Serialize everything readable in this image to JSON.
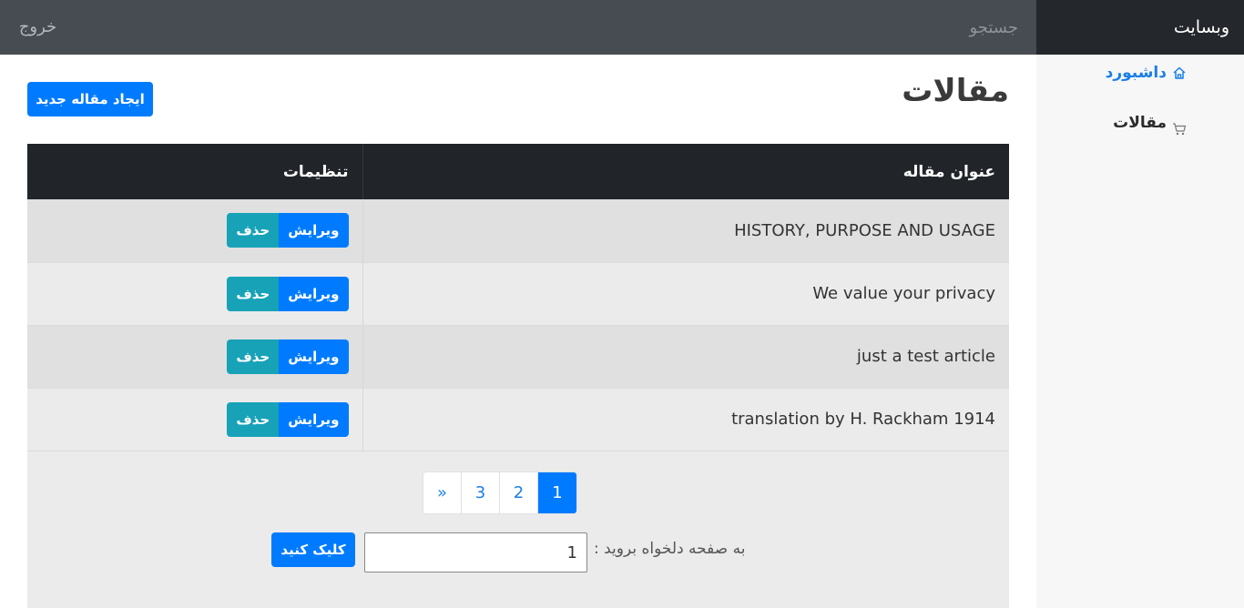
{
  "topbar": {
    "brand": "وبسایت",
    "search_placeholder": "جستجو",
    "logout_label": "خروج"
  },
  "sidebar": {
    "items": [
      {
        "label": "داشبورد",
        "icon": "home-icon",
        "active": true
      },
      {
        "label": "مقالات",
        "icon": "cart-icon",
        "active": false
      }
    ]
  },
  "main": {
    "title": "مقالات",
    "new_button_label": "ایجاد مقاله جدید"
  },
  "table": {
    "headers": [
      "عنوان مقاله",
      "تنظیمات"
    ],
    "edit_label": "ویرایش",
    "delete_label": "حذف",
    "rows": [
      {
        "title": "HISTORY, PURPOSE AND USAGE"
      },
      {
        "title": "We value your privacy"
      },
      {
        "title": "just a test article"
      },
      {
        "title": "translation by H. Rackham 1914"
      }
    ]
  },
  "pagination": {
    "pages": [
      "1",
      "2",
      "3"
    ],
    "next_label": "»",
    "active_page": "1"
  },
  "goto": {
    "label": "به صفحه دلخواه بروید :",
    "value": "1",
    "button_label": "کلیک کنید"
  },
  "colors": {
    "primary": "#007bff",
    "info": "#17a2b8",
    "dark": "#212529"
  }
}
